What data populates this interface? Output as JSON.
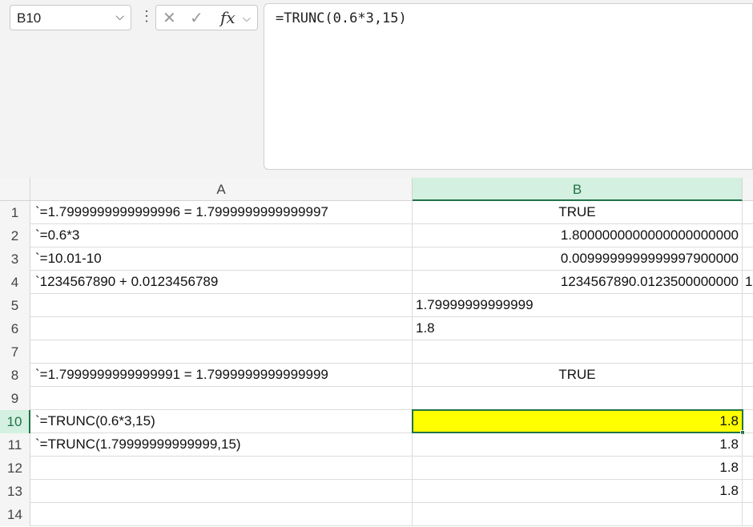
{
  "name_box": "B10",
  "formula": "=TRUNC(0.6*3,15)",
  "icons": {
    "cancel": "✕",
    "enter": "✓",
    "fx": "fx"
  },
  "columns": [
    "A",
    "B"
  ],
  "selected_cell": "B10",
  "highlight_color": "#ffff00",
  "rows": [
    {
      "n": "1",
      "a": "`=1.7999999999999996 = 1.7999999999999997",
      "b": "TRUE",
      "align": "c",
      "c": ""
    },
    {
      "n": "2",
      "a": "`=0.6*3",
      "b": "1.8000000000000000000000",
      "align": "r",
      "c": ""
    },
    {
      "n": "3",
      "a": "`=10.01-10",
      "b": "0.0099999999999997900000",
      "align": "r",
      "c": ""
    },
    {
      "n": "4",
      "a": "`1234567890 + 0.0123456789",
      "b": "1234567890.0123500000000",
      "align": "r",
      "c": "1"
    },
    {
      "n": "5",
      "a": "",
      "b": "1.79999999999999",
      "align": "l",
      "c": ""
    },
    {
      "n": "6",
      "a": "",
      "b": "1.8",
      "align": "l",
      "c": ""
    },
    {
      "n": "7",
      "a": "",
      "b": "",
      "align": "l",
      "c": ""
    },
    {
      "n": "8",
      "a": "`=1.7999999999999991 = 1.7999999999999999",
      "b": "TRUE",
      "align": "c",
      "c": ""
    },
    {
      "n": "9",
      "a": "",
      "b": "",
      "align": "l",
      "c": ""
    },
    {
      "n": "10",
      "a": "`=TRUNC(0.6*3,15)",
      "b": "1.8",
      "align": "r",
      "c": ""
    },
    {
      "n": "11",
      "a": "`=TRUNC(1.79999999999999,15)",
      "b": "1.8",
      "align": "r",
      "c": ""
    },
    {
      "n": "12",
      "a": "",
      "b": "1.8",
      "align": "r",
      "c": ""
    },
    {
      "n": "13",
      "a": "",
      "b": "1.8",
      "align": "r",
      "c": ""
    },
    {
      "n": "14",
      "a": "",
      "b": "",
      "align": "l",
      "c": ""
    }
  ]
}
